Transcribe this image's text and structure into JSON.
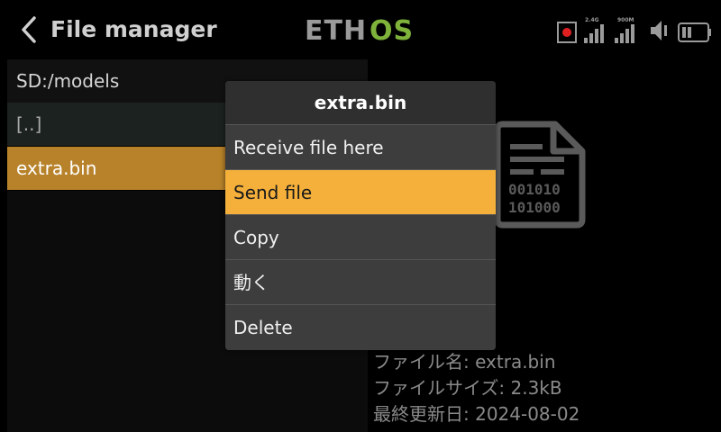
{
  "header": {
    "title": "File manager",
    "logo_text": "ETHOS",
    "back_icon": "chevron-left-icon",
    "status": {
      "rec_indicator": "record-icon",
      "signal_1_label": "2.4G",
      "signal_2_label": "900M",
      "volume_icon": "speaker-icon",
      "battery_icon": "battery-icon"
    }
  },
  "file_list": {
    "path": "SD:/models",
    "items": [
      {
        "name": "[..]"
      },
      {
        "name": "extra.bin"
      }
    ]
  },
  "details": {
    "file_name": "ファイル名: extra.bin",
    "file_size": "ファイルサイズ: 2.3kB",
    "modified": "最終更新日: 2024-08-02",
    "icon": "binary-file-icon"
  },
  "menu": {
    "title": "extra.bin",
    "items": [
      {
        "label": "Receive file here"
      },
      {
        "label": "Send file"
      },
      {
        "label": "Copy"
      },
      {
        "label": "動く"
      },
      {
        "label": "Delete"
      }
    ]
  },
  "colors": {
    "accent": "#f4b03a",
    "selected_row": "#b7822a",
    "logo_green": "#7fb23a"
  }
}
